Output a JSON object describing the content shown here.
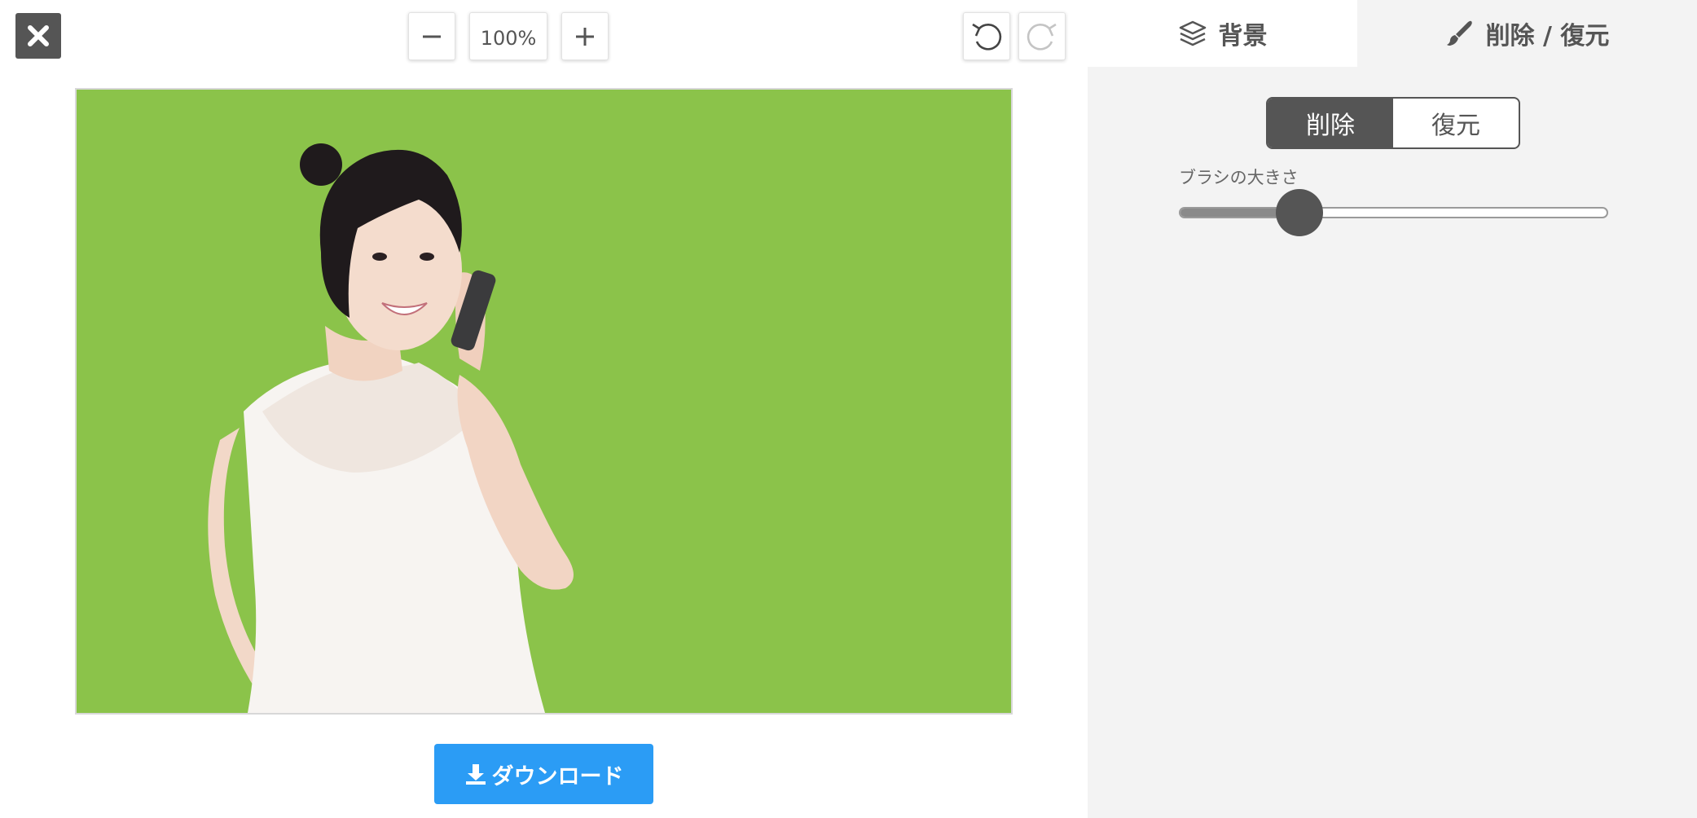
{
  "toolbar": {
    "zoom_level": "100%"
  },
  "right_panel": {
    "tabs": [
      {
        "label": "背景",
        "icon": "layers-icon"
      },
      {
        "label": "削除 / 復元",
        "icon": "brush-icon"
      }
    ],
    "mode_options": [
      "削除",
      "復元"
    ],
    "active_mode": "削除",
    "brush_size_label": "ブラシの大きさ",
    "brush_size_fraction": 0.28
  },
  "download_label": "ダウンロード",
  "colors": {
    "canvas_background": "#8bc34a",
    "download_button": "#2b9cf5",
    "dark_gray": "#555555",
    "panel_background": "#f3f3f3"
  }
}
